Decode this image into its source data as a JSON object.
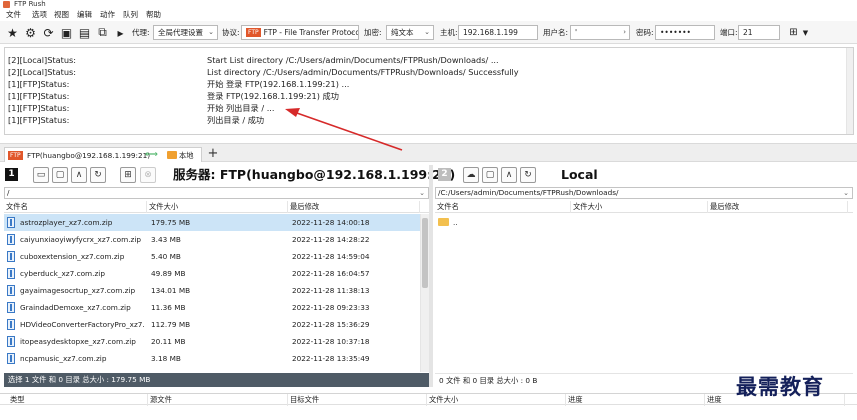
{
  "window": {
    "title": "FTP Rush"
  },
  "menu": [
    "文件",
    "选项",
    "视图",
    "编辑",
    "动作",
    "队列",
    "帮助"
  ],
  "toolbar": {
    "proxy_label": "代理:",
    "proxy_value": "全局代理设置",
    "protocol_label": "协议:",
    "protocol_badge": "FTP",
    "protocol_value": "FTP - File Transfer Protoco",
    "encryption_label": "加密:",
    "encryption_value": "纯文本",
    "host_label": "主机:",
    "host_value": "192.168.1.199",
    "user_label": "用户名:",
    "user_value": "'",
    "password_label": "密码:",
    "password_value": "•••••••",
    "port_label": "端口:",
    "port_value": "21"
  },
  "log": [
    {
      "source": "[2][Local]Status:",
      "message": "Start List directory /C:/Users/admin/Documents/FTPRush/Downloads/ ..."
    },
    {
      "source": "[2][Local]Status:",
      "message": "List directory /C:/Users/admin/Documents/FTPRush/Downloads/ Successfully"
    },
    {
      "source": "[1][FTP]Status:",
      "message": "开始 登录 FTP(192.168.1.199:21) ..."
    },
    {
      "source": "[1][FTP]Status:",
      "message": "登录 FTP(192.168.1.199:21) 成功"
    },
    {
      "source": "[1][FTP]Status:",
      "message": "开始 列出目录 / ..."
    },
    {
      "source": "[1][FTP]Status:",
      "message": "列出目录 / 成功"
    }
  ],
  "tab": {
    "badge": "FTP",
    "label": "FTP(huangbo@192.168.1.199:21)",
    "local_label": "本地",
    "add": "+"
  },
  "left_pane": {
    "number": "1",
    "title": "服务器:  FTP(huangbo@192.168.1.199:21)",
    "path": "/",
    "columns": [
      "文件名",
      "文件大小",
      "最后修改"
    ],
    "files": [
      {
        "name": "astrozplayer_xz7.com.zip",
        "size": "179.75 MB",
        "modified": "2022-11-28 14:00:18",
        "selected": true
      },
      {
        "name": "caiyunxiaoyiwyfycrx_xz7.com.zip",
        "size": "3.43 MB",
        "modified": "2022-11-28 14:28:22"
      },
      {
        "name": "cuboxextension_xz7.com.zip",
        "size": "5.40 MB",
        "modified": "2022-11-28 14:59:04"
      },
      {
        "name": "cyberduck_xz7.com.zip",
        "size": "49.89 MB",
        "modified": "2022-11-28 16:04:57"
      },
      {
        "name": "gayaimagesocrtup_xz7.com.zip",
        "size": "134.01 MB",
        "modified": "2022-11-28 11:38:13"
      },
      {
        "name": "GraindadDemoxe_xz7.com.zip",
        "size": "11.36 MB",
        "modified": "2022-11-28 09:23:33"
      },
      {
        "name": "HDVideoConverterFactoryPro_xz7.c",
        "size": "112.79 MB",
        "modified": "2022-11-28 15:36:29"
      },
      {
        "name": "itopeasydesktopxe_xz7.com.zip",
        "size": "20.11 MB",
        "modified": "2022-11-28 10:37:18"
      },
      {
        "name": "ncpamusic_xz7.com.zip",
        "size": "3.18 MB",
        "modified": "2022-11-28 13:35:49"
      }
    ],
    "status": "选择 1 文件 和 0 目录 总大小 : 179.75 MB"
  },
  "right_pane": {
    "number": "2",
    "title": "Local",
    "path": "/C:/Users/admin/Documents/FTPRush/Downloads/",
    "columns": [
      "文件名",
      "文件大小",
      "最后修改"
    ],
    "files": [
      {
        "name": "..",
        "is_folder": true
      }
    ],
    "status": "0 文件 和 0 目录 总大小 : 0 B"
  },
  "queue": {
    "columns": [
      "类型",
      "源文件",
      "目标文件",
      "文件大小",
      "进度",
      "进度"
    ]
  },
  "watermark": "最需教育",
  "colors": {
    "selection": "#cce4f7",
    "ftp_badge": "#e1572b",
    "arrow": "#d62a2a",
    "status_bar_left": "#4f5b66"
  }
}
